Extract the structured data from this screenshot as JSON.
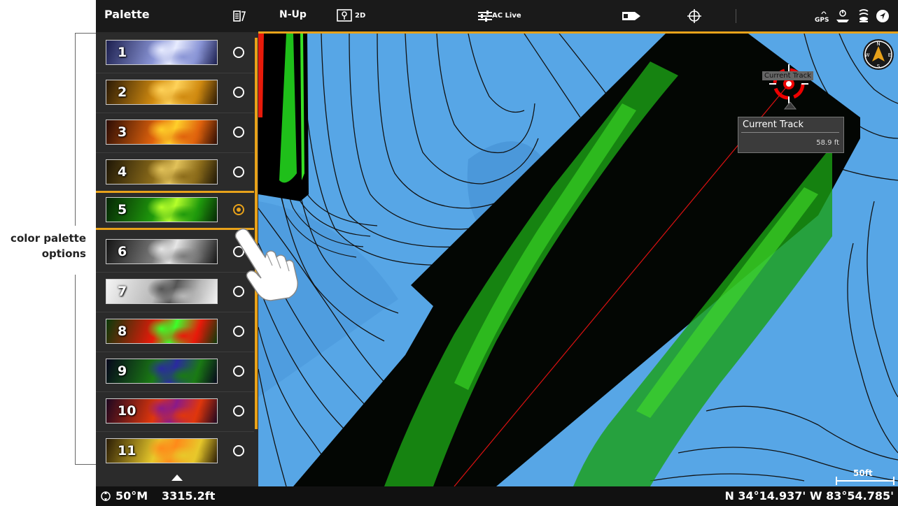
{
  "annotation": {
    "line1": "color palette",
    "line2": "options"
  },
  "topbar": {
    "palette_title": "Palette",
    "orientation": "N-Up",
    "view_mode": "2D",
    "ac_live": "AC Live",
    "gps": "GPS"
  },
  "palette": {
    "selected_index": 5,
    "items": [
      {
        "label": "1",
        "colors": [
          "#1c1f4e",
          "#8a95d6",
          "#e8ecff"
        ]
      },
      {
        "label": "2",
        "colors": [
          "#2b1a05",
          "#d08a10",
          "#ffd35a"
        ]
      },
      {
        "label": "3",
        "colors": [
          "#2c0c04",
          "#e0620c",
          "#ffd02a"
        ]
      },
      {
        "label": "4",
        "colors": [
          "#1e1606",
          "#8c6c1a",
          "#e2c25a"
        ]
      },
      {
        "label": "5",
        "colors": [
          "#052605",
          "#1f9a0c",
          "#b6ff2a"
        ]
      },
      {
        "label": "6",
        "colors": [
          "#141414",
          "#7a7a7a",
          "#e6e6e6"
        ]
      },
      {
        "label": "7",
        "colors": [
          "#f4f4f4",
          "#b8b8b8",
          "#555555"
        ]
      },
      {
        "label": "8",
        "colors": [
          "#0a3a0a",
          "#e81a0a",
          "#3cff2a"
        ]
      },
      {
        "label": "9",
        "colors": [
          "#06061c",
          "#1a7a14",
          "#2a2aa0"
        ]
      },
      {
        "label": "10",
        "colors": [
          "#1c0620",
          "#e0360c",
          "#8a1a8a"
        ]
      },
      {
        "label": "11",
        "colors": [
          "#2a1c05",
          "#e8c82a",
          "#ff8a1a"
        ]
      }
    ]
  },
  "popup": {
    "title": "Current Track",
    "value": "58.9 ft"
  },
  "track_tooltip": "Current Track",
  "scale_label": "50ft",
  "status": {
    "heading": "50°M",
    "depth": "3315.2ft",
    "coords": "N 34°14.937' W 83°54.785'"
  },
  "colors": {
    "accent": "#e8a21a",
    "water": "#57a6e6",
    "sonar": "#1fbf1a"
  }
}
